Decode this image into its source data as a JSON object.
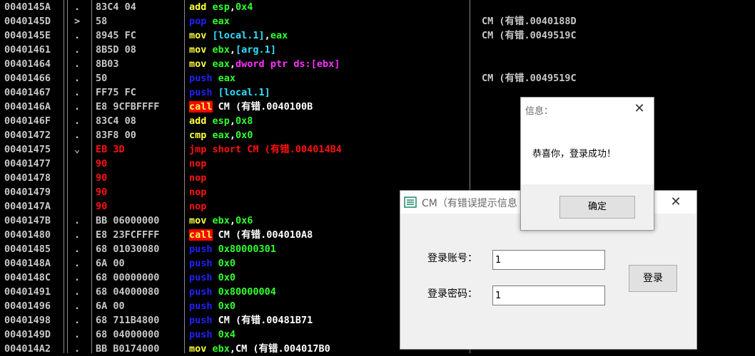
{
  "disasm": {
    "rows": [
      {
        "addr": "0040145A",
        "mark": ".",
        "bytes": "83C4 04",
        "toks": [
          [
            "add ",
            "mnem-add"
          ],
          [
            "esp",
            "reg"
          ],
          [
            ",",
            "plain"
          ],
          [
            "0x4",
            "num"
          ]
        ],
        "comment": ""
      },
      {
        "addr": "0040145D",
        "mark": ">",
        "bytes": "58",
        "toks": [
          [
            "pop ",
            "mnem-pop"
          ],
          [
            "eax",
            "reg"
          ]
        ],
        "comment": "CM (有错.0040188D"
      },
      {
        "addr": "0040145E",
        "mark": ".",
        "bytes": "8945 FC",
        "toks": [
          [
            "mov ",
            "mnem-mov"
          ],
          [
            "[local.1]",
            "mem"
          ],
          [
            ",",
            "plain"
          ],
          [
            "eax",
            "reg"
          ]
        ],
        "comment": "CM (有错.0049519C"
      },
      {
        "addr": "00401461",
        "mark": ".",
        "bytes": "8B5D 08",
        "toks": [
          [
            "mov ",
            "mnem-mov"
          ],
          [
            "ebx",
            "reg"
          ],
          [
            ",",
            "plain"
          ],
          [
            "[arg.1]",
            "mem"
          ]
        ],
        "comment": ""
      },
      {
        "addr": "00401464",
        "mark": ".",
        "bytes": "8B03",
        "toks": [
          [
            "mov ",
            "mnem-mov"
          ],
          [
            "eax",
            "reg"
          ],
          [
            ",",
            "plain"
          ],
          [
            "dword ptr ds:[ebx]",
            "ptr"
          ]
        ],
        "comment": ""
      },
      {
        "addr": "00401466",
        "mark": ".",
        "bytes": "50",
        "toks": [
          [
            "push ",
            "mnem-push"
          ],
          [
            "eax",
            "reg"
          ]
        ],
        "comment": "CM (有错.0049519C"
      },
      {
        "addr": "00401467",
        "mark": ".",
        "bytes": "FF75 FC",
        "toks": [
          [
            "push ",
            "mnem-push"
          ],
          [
            "[local.1]",
            "mem"
          ]
        ],
        "comment": ""
      },
      {
        "addr": "0040146A",
        "mark": ".",
        "bytes": "E8 9CFBFFFF",
        "toks": [
          [
            "call",
            "mnem-call"
          ],
          [
            " CM (有错.0040100B",
            "tgt"
          ]
        ],
        "comment": ""
      },
      {
        "addr": "0040146F",
        "mark": ".",
        "bytes": "83C4 08",
        "toks": [
          [
            "add ",
            "mnem-add"
          ],
          [
            "esp",
            "reg"
          ],
          [
            ",",
            "plain"
          ],
          [
            "0x8",
            "num"
          ]
        ],
        "comment": ""
      },
      {
        "addr": "00401472",
        "mark": ".",
        "bytes": "83F8 00",
        "toks": [
          [
            "cmp ",
            "mnem-cmp"
          ],
          [
            "eax",
            "reg"
          ],
          [
            ",",
            "plain"
          ],
          [
            "0x0",
            "num"
          ]
        ],
        "comment": ""
      },
      {
        "addr": "00401475",
        "mark": "⌄",
        "bytes": "EB 3D",
        "red": true,
        "toks": [
          [
            "jmp short CM (有错.004014B4",
            "mnem-jmp"
          ]
        ],
        "comment": ""
      },
      {
        "addr": "00401477",
        "mark": "",
        "bytes": "90",
        "red": true,
        "toks": [
          [
            "nop",
            "mnem-nop"
          ]
        ],
        "comment": ""
      },
      {
        "addr": "00401478",
        "mark": "",
        "bytes": "90",
        "red": true,
        "toks": [
          [
            "nop",
            "mnem-nop"
          ]
        ],
        "comment": ""
      },
      {
        "addr": "00401479",
        "mark": "",
        "bytes": "90",
        "red": true,
        "toks": [
          [
            "nop",
            "mnem-nop"
          ]
        ],
        "comment": ""
      },
      {
        "addr": "0040147A",
        "mark": "",
        "bytes": "90",
        "red": true,
        "toks": [
          [
            "nop",
            "mnem-nop"
          ]
        ],
        "comment": ""
      },
      {
        "addr": "0040147B",
        "mark": ".",
        "bytes": "BB 06000000",
        "toks": [
          [
            "mov ",
            "mnem-mov"
          ],
          [
            "ebx",
            "reg"
          ],
          [
            ",",
            "plain"
          ],
          [
            "0x6",
            "num"
          ]
        ],
        "comment": ""
      },
      {
        "addr": "00401480",
        "mark": ".",
        "bytes": "E8 23FCFFFF",
        "toks": [
          [
            "call",
            "mnem-call"
          ],
          [
            " CM (有错.004010A8",
            "tgt"
          ]
        ],
        "comment": ""
      },
      {
        "addr": "00401485",
        "mark": ".",
        "bytes": "68 01030080",
        "toks": [
          [
            "push ",
            "mnem-push"
          ],
          [
            "0x80000301",
            "num"
          ]
        ],
        "comment": ""
      },
      {
        "addr": "0040148A",
        "mark": ".",
        "bytes": "6A 00",
        "toks": [
          [
            "push ",
            "mnem-push"
          ],
          [
            "0x0",
            "num"
          ]
        ],
        "comment": ""
      },
      {
        "addr": "0040148C",
        "mark": ".",
        "bytes": "68 00000000",
        "toks": [
          [
            "push ",
            "mnem-push"
          ],
          [
            "0x0",
            "num"
          ]
        ],
        "comment": ""
      },
      {
        "addr": "00401491",
        "mark": ".",
        "bytes": "68 04000080",
        "toks": [
          [
            "push ",
            "mnem-push"
          ],
          [
            "0x80000004",
            "num"
          ]
        ],
        "comment": ""
      },
      {
        "addr": "00401496",
        "mark": ".",
        "bytes": "6A 00",
        "toks": [
          [
            "push ",
            "mnem-push"
          ],
          [
            "0x0",
            "num"
          ]
        ],
        "comment": ""
      },
      {
        "addr": "00401498",
        "mark": ".",
        "bytes": "68 711B4800",
        "toks": [
          [
            "push ",
            "mnem-push"
          ],
          [
            "CM (有错.00481B71",
            "tgt"
          ]
        ],
        "comment": ""
      },
      {
        "addr": "0040149D",
        "mark": ".",
        "bytes": "68 04000000",
        "toks": [
          [
            "push ",
            "mnem-push"
          ],
          [
            "0x4",
            "num"
          ]
        ],
        "comment": ""
      },
      {
        "addr": "004014A2",
        "mark": ".",
        "bytes": "BB B0174000",
        "toks": [
          [
            "mov ",
            "mnem-mov"
          ],
          [
            "ebx",
            "reg"
          ],
          [
            ",",
            "plain"
          ],
          [
            "CM (有错.004017B0",
            "tgt"
          ]
        ],
        "comment": ""
      }
    ]
  },
  "cm_window": {
    "title": "CM（有错误提示信息",
    "close": "✕",
    "account_label": "登录账号：",
    "account_value": "1",
    "password_label": "登录密码：",
    "password_value": "1",
    "login_button": "登录"
  },
  "message_box": {
    "title": "信息：",
    "close": "✕",
    "text": "恭喜你，登录成功！",
    "ok_button": "确定"
  }
}
